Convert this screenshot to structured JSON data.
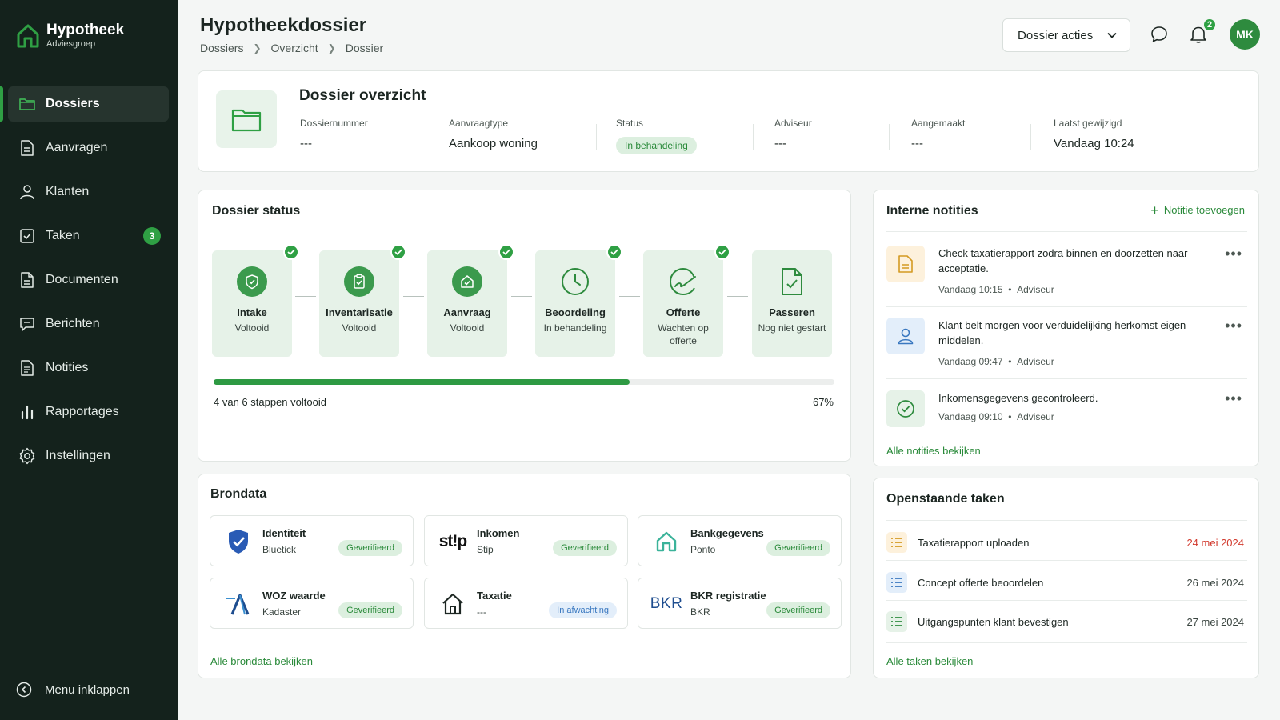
{
  "brand": {
    "name": "Hypotheek",
    "sub": "Adviesgroep"
  },
  "sidebar": {
    "items": [
      {
        "label": "Dossiers",
        "icon": "folder-icon",
        "active": true
      },
      {
        "label": "Aanvragen",
        "icon": "document-icon"
      },
      {
        "label": "Klanten",
        "icon": "user-icon"
      },
      {
        "label": "Taken",
        "icon": "checkbox-icon",
        "badge": "3"
      },
      {
        "label": "Documenten",
        "icon": "file-icon"
      },
      {
        "label": "Berichten",
        "icon": "message-icon"
      },
      {
        "label": "Notities",
        "icon": "note-icon"
      },
      {
        "label": "Rapportages",
        "icon": "bar-chart-icon"
      },
      {
        "label": "Instellingen",
        "icon": "gear-icon"
      }
    ],
    "collapse_label": "Menu inklappen"
  },
  "header": {
    "title": "Hypotheekdossier",
    "breadcrumb": [
      "Dossiers",
      "Overzicht",
      "Dossier"
    ],
    "actions_label": "Dossier acties",
    "notification_count": "2",
    "avatar_initials": "MK"
  },
  "overview": {
    "title": "Dossier overzicht",
    "fields": {
      "dossiernummer": {
        "label": "Dossiernummer",
        "value": "---"
      },
      "aanvraagtype": {
        "label": "Aanvraagtype",
        "value": "Aankoop woning"
      },
      "status": {
        "label": "Status",
        "value": "In behandeling"
      },
      "adviseur": {
        "label": "Adviseur",
        "value": "---"
      },
      "aangemaakt": {
        "label": "Aangemaakt",
        "value": "---"
      },
      "gewijzigd": {
        "label": "Laatst gewijzigd",
        "value": "Vandaag 10:24"
      }
    }
  },
  "status": {
    "title": "Dossier status",
    "steps": [
      {
        "name": "Intake",
        "sub": "Voltooid",
        "icon": "shield-check-icon",
        "checked": true
      },
      {
        "name": "Inventarisatie",
        "sub": "Voltooid",
        "icon": "clipboard-check-icon",
        "checked": true
      },
      {
        "name": "Aanvraag",
        "sub": "Voltooid",
        "icon": "house-check-icon",
        "checked": true
      },
      {
        "name": "Beoordeling",
        "sub": "In behandeling",
        "icon": "clock-icon",
        "checked": true
      },
      {
        "name": "Offerte",
        "sub": "Wachten op offerte",
        "icon": "signature-icon",
        "checked": true
      },
      {
        "name": "Passeren",
        "sub": "Nog niet gestart",
        "icon": "document-check-icon",
        "checked": false
      }
    ],
    "progress_text": "4 van 6 stappen voltooid",
    "progress_percent": "67%",
    "progress_value": 0.67
  },
  "brondata": {
    "title": "Brondata",
    "sources": [
      {
        "name": "Identiteit",
        "provider": "Bluetick",
        "status": "Geverifieerd",
        "logo": "bluetick-shield-icon"
      },
      {
        "name": "Inkomen",
        "provider": "Stip",
        "status": "Geverifieerd",
        "logo": "stip-logo",
        "logo_text": "st!p"
      },
      {
        "name": "Bankgegevens",
        "provider": "Ponto",
        "status": "Geverifieerd",
        "logo": "ponto-house-icon"
      },
      {
        "name": "WOZ waarde",
        "provider": "Kadaster",
        "status": "Geverifieerd",
        "logo": "kadaster-logo"
      },
      {
        "name": "Taxatie",
        "provider": "---",
        "status": "In afwachting",
        "logo": "house-icon"
      },
      {
        "name": "BKR registratie",
        "provider": "BKR",
        "status": "Geverifieerd",
        "logo": "bkr-logo",
        "logo_text": "BKR"
      }
    ],
    "all_link": "Alle brondata bekijken"
  },
  "notes": {
    "title": "Interne notities",
    "add_label": "Notitie toevoegen",
    "items": [
      {
        "text": "Check taxatierapport zodra binnen en doorzetten naar acceptatie.",
        "time": "Vandaag 10:15",
        "author": "Adviseur",
        "icon": "document-note-icon"
      },
      {
        "text": "Klant belt morgen voor verduidelijking herkomst eigen middelen.",
        "time": "Vandaag 09:47",
        "author": "Adviseur",
        "icon": "user-icon"
      },
      {
        "text": "Inkomensgegevens gecontroleerd.",
        "time": "Vandaag 09:10",
        "author": "Adviseur",
        "icon": "check-circle-icon"
      }
    ],
    "all_link": "Alle notities bekijken"
  },
  "tasks": {
    "title": "Openstaande taken",
    "items": [
      {
        "name": "Taxatierapport uploaden",
        "date": "24 mei 2024",
        "overdue": true
      },
      {
        "name": "Concept offerte beoordelen",
        "date": "26 mei 2024",
        "overdue": false
      },
      {
        "name": "Uitgangspunten klant bevestigen",
        "date": "27 mei 2024",
        "overdue": false
      }
    ],
    "all_link": "Alle taken bekijken"
  },
  "colors": {
    "accent": "#2fa044",
    "sidebar": "#14221c",
    "overdue": "#d23a2e"
  },
  "bullet": "•"
}
